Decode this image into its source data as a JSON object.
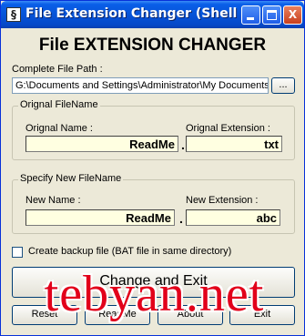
{
  "window": {
    "title": "File Extension Changer (Shell ...",
    "minimize_label": "",
    "maximize_label": "",
    "close_label": "X"
  },
  "heading": "File EXTENSION CHANGER",
  "path": {
    "label": "Complete File Path :",
    "value": "G:\\Documents and Settings\\Administrator\\My Documents\\",
    "browse_label": "..."
  },
  "original": {
    "group_label": "Orignal FileName",
    "name_label": "Orignal Name :",
    "name_value": "ReadMe",
    "ext_label": "Orignal Extension :",
    "ext_value": "txt",
    "separator": "."
  },
  "new_name": {
    "group_label": "Specify New FileName",
    "name_label": "New Name :",
    "name_value": "ReadMe",
    "ext_label": "New Extension :",
    "ext_value": "abc",
    "separator": "."
  },
  "backup": {
    "label": "Create backup file (BAT file in same directory)",
    "checked": false
  },
  "buttons": {
    "change_exit": "Change and Exit",
    "reset": "Reset",
    "readme": "ReadMe",
    "about": "About",
    "exit": "Exit"
  },
  "watermark": "tebyan.net",
  "colors": {
    "titlebar": "#0654d8",
    "window_bg": "#ece9d8",
    "field_bg": "#ffffe1",
    "watermark": "#e2001a"
  }
}
